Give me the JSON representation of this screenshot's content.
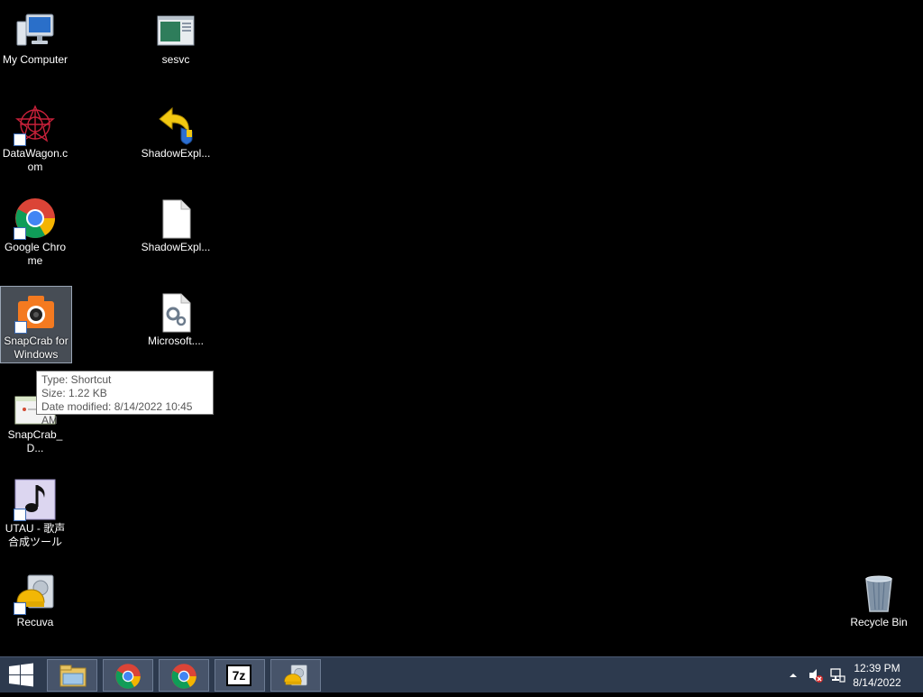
{
  "desktop": {
    "icons": [
      {
        "label": "My Computer",
        "icon": "computer-icon"
      },
      {
        "label": "sesvc",
        "icon": "application-window-icon"
      },
      {
        "label": "DataWagon.c om",
        "icon": "datawagon-icon"
      },
      {
        "label": "ShadowExpl...",
        "icon": "shadowexplorer-icon"
      },
      {
        "label": "Google Chrome",
        "icon": "chrome-icon"
      },
      {
        "label": "ShadowExpl...",
        "icon": "blank-file-icon"
      },
      {
        "label": "SnapCrab for Windows",
        "icon": "snapcrab-camera-icon"
      },
      {
        "label": "Microsoft....",
        "icon": "settings-file-icon"
      },
      {
        "label": "SnapCrab_D...",
        "icon": "snapcrab-document-icon"
      },
      {
        "label": "UTAU - 歌声 合成ツール",
        "icon": "utau-music-note-icon"
      },
      {
        "label": "Recuva",
        "icon": "recuva-icon"
      },
      {
        "label": "Recycle Bin",
        "icon": "recycle-bin-icon"
      }
    ]
  },
  "tooltip": {
    "type": "Type: Shortcut",
    "size": "Size: 1.22 KB",
    "date": "Date modified: 8/14/2022 10:45 AM"
  },
  "taskbar": {
    "buttons": [
      {
        "icon": "file-explorer-icon"
      },
      {
        "icon": "chrome-icon"
      },
      {
        "icon": "chrome-icon"
      },
      {
        "icon": "7zip-icon",
        "text": "7z"
      },
      {
        "icon": "recuva-icon"
      }
    ],
    "clock": {
      "time": "12:39 PM",
      "date": "8/14/2022"
    }
  },
  "colors": {
    "desktop_bg": "#000000",
    "taskbar_bg": "#2d3a4e",
    "chrome_red": "#db4437",
    "chrome_green": "#0f9d58",
    "chrome_yellow": "#f4b400",
    "chrome_blue": "#4285f4"
  }
}
